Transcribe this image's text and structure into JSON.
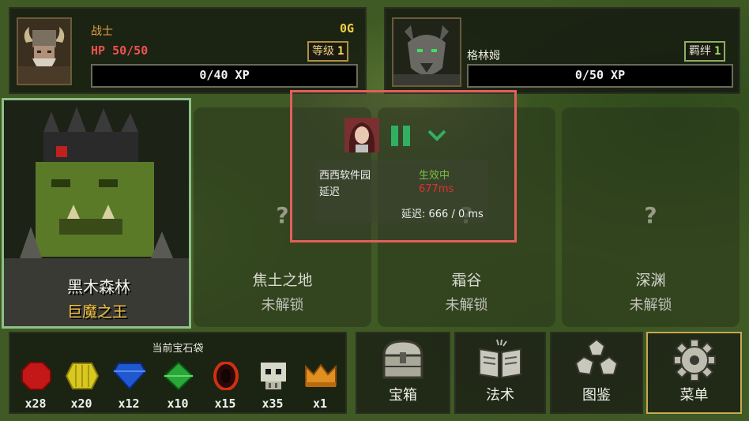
{
  "hero": {
    "class_name": "战士",
    "hp": "HP 50/50",
    "gold": "0G",
    "level_label": "等级",
    "level_value": "1",
    "xp": "0/40 XP"
  },
  "companion": {
    "name": "格林姆",
    "bond_label": "羁绊",
    "bond_value": "1",
    "xp": "0/50 XP"
  },
  "boss": {
    "location": "黑木森林",
    "title": "巨魔之王"
  },
  "zones": [
    {
      "mark": "?",
      "name": "焦土之地",
      "status": "未解锁"
    },
    {
      "mark": "?",
      "name": "霜谷",
      "status": "未解锁"
    },
    {
      "mark": "?",
      "name": "深渊",
      "status": "未解锁"
    }
  ],
  "gem_bag": {
    "title": "当前宝石袋",
    "gems": [
      {
        "icon": "red-octagon-gem-icon",
        "color": "#c41818",
        "count": "x28"
      },
      {
        "icon": "yellow-hex-gem-icon",
        "color": "#d8c820",
        "count": "x20"
      },
      {
        "icon": "blue-diamond-gem-icon",
        "color": "#2058d0",
        "count": "x12"
      },
      {
        "icon": "green-rhombus-gem-icon",
        "color": "#28a838",
        "count": "x10"
      },
      {
        "icon": "dark-ring-gem-icon",
        "color": "#d03010",
        "count": "x15"
      },
      {
        "icon": "skull-icon",
        "color": "#d8d8c8",
        "count": "x35"
      },
      {
        "icon": "crown-icon",
        "color": "#e09020",
        "count": "x1"
      }
    ]
  },
  "menu_buttons": [
    {
      "icon": "treasure-chest-icon",
      "label": "宝箱"
    },
    {
      "icon": "spellbook-icon",
      "label": "法术"
    },
    {
      "icon": "dice-icon",
      "label": "图鉴"
    },
    {
      "icon": "gear-icon",
      "label": "菜单"
    }
  ],
  "overlay": {
    "app_name": "西西软件园",
    "status": "生效中",
    "delay_label": "延迟",
    "delay_value": "677ms",
    "delay_summary": "延迟: 666 / 0 ms",
    "status_color": "#7ac040",
    "delay_color": "#e03030"
  }
}
